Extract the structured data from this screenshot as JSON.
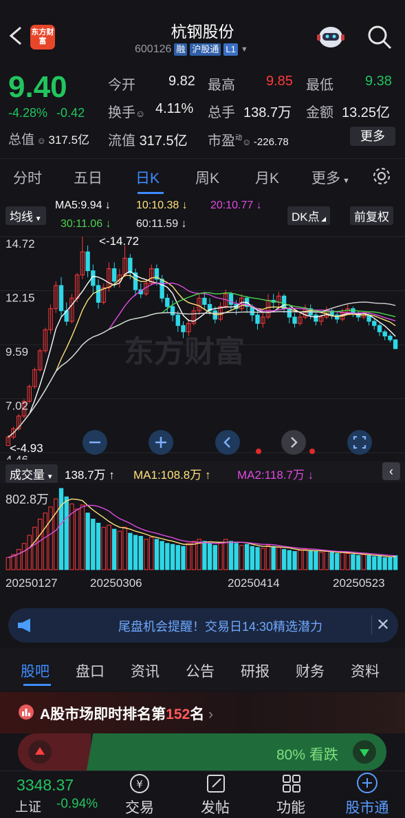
{
  "header": {
    "logo_text": "东方财富",
    "title": "杭钢股份",
    "code": "600126",
    "tags": [
      "融",
      "沪股通",
      "L1"
    ]
  },
  "quote": {
    "price": "9.40",
    "change_pct": "-4.28%",
    "change": "-0.42",
    "fields": [
      {
        "label": "今开",
        "value": "9.82",
        "color": "#f0f0f0"
      },
      {
        "label": "最高",
        "value": "9.85",
        "color": "#ff3a3a"
      },
      {
        "label": "最低",
        "value": "9.38",
        "color": "#22c45e"
      },
      {
        "label": "换手",
        "value": "4.11%",
        "color": "#f0f0f0"
      },
      {
        "label": "总手",
        "value": "138.7万",
        "color": "#f0f0f0"
      },
      {
        "label": "金额",
        "value": "13.25亿",
        "color": "#f0f0f0"
      }
    ],
    "total_cap_label": "总值",
    "total_cap": "317.5亿",
    "float_cap_label": "流值",
    "float_cap": "317.5亿",
    "pe_label": "市盈",
    "pe_sup": "动",
    "pe": "-226.78",
    "more": "更多"
  },
  "tabs": [
    "分时",
    "五日",
    "日K",
    "周K",
    "月K",
    "更多"
  ],
  "active_tab": "日K",
  "chart_controls": {
    "ma_selector": "均线",
    "ma5": "MA5:9.94 ↓",
    "ma10": "10:10.38 ↓",
    "ma20": "20:10.77 ↓",
    "ma30": "30:11.06 ↓",
    "ma60": "60:11.59 ↓",
    "dk": "DK点",
    "adjust": "前复权",
    "high_marker": "<-14.72",
    "low_marker": "<-4.93",
    "watermark": "东方财富",
    "y_axis": [
      "14.72",
      "12.15",
      "9.59",
      "7.02",
      "4.46"
    ],
    "vol_selector": "成交量",
    "vol": "138.7万 ↑",
    "vol_ma1": "MA1:108.8万 ↑",
    "vol_ma2": "MA2:118.7万 ↓",
    "vol_max": "802.8万",
    "dates": [
      "20250127",
      "20250306",
      "20250414",
      "20250523"
    ]
  },
  "colors": {
    "up": "#ff3a3a",
    "down": "#2fd7e6",
    "ma5": "#ffffff",
    "ma10": "#ffe27a",
    "ma20": "#e04be0",
    "ma30": "#4fd24f",
    "ma60": "#d8d8d8",
    "accent": "#3f8cff",
    "green": "#22c45e"
  },
  "chart_data": {
    "type": "candlestick",
    "y_range": [
      4.46,
      14.72
    ],
    "candles": [
      [
        4.8,
        5.2,
        5.3,
        4.9
      ],
      [
        5.2,
        5.6,
        5.7,
        5.1
      ],
      [
        5.6,
        6.2,
        6.3,
        5.5
      ],
      [
        6.2,
        6.9,
        7.0,
        6.1
      ],
      [
        6.9,
        7.6,
        7.7,
        6.8
      ],
      [
        7.6,
        8.4,
        8.5,
        7.5
      ],
      [
        8.4,
        9.3,
        9.4,
        8.3
      ],
      [
        9.3,
        10.3,
        10.4,
        9.2
      ],
      [
        10.3,
        11.3,
        11.5,
        10.1
      ],
      [
        11.3,
        12.4,
        12.6,
        11.1
      ],
      [
        12.4,
        11.2,
        12.8,
        10.9
      ],
      [
        11.2,
        10.7,
        11.6,
        10.5
      ],
      [
        10.7,
        11.8,
        12.0,
        10.6
      ],
      [
        11.8,
        12.9,
        13.0,
        11.6
      ],
      [
        12.9,
        14.0,
        14.72,
        12.7
      ],
      [
        14.0,
        13.1,
        14.3,
        12.8
      ],
      [
        13.1,
        12.4,
        13.4,
        12.0
      ],
      [
        12.4,
        11.6,
        12.7,
        11.3
      ],
      [
        11.6,
        12.3,
        12.5,
        11.5
      ],
      [
        12.3,
        13.2,
        13.5,
        12.1
      ],
      [
        13.2,
        12.6,
        13.5,
        12.3
      ],
      [
        12.6,
        12.9,
        13.2,
        12.3
      ],
      [
        12.9,
        13.7,
        14.3,
        12.8
      ],
      [
        13.7,
        13.0,
        13.9,
        12.7
      ],
      [
        13.0,
        12.2,
        13.2,
        11.9
      ],
      [
        12.2,
        12.0,
        12.5,
        11.8
      ],
      [
        12.0,
        12.5,
        12.7,
        11.9
      ],
      [
        12.5,
        13.2,
        13.4,
        12.4
      ],
      [
        13.2,
        12.7,
        13.4,
        12.4
      ],
      [
        12.7,
        11.8,
        12.9,
        11.6
      ],
      [
        11.8,
        11.4,
        12.0,
        11.1
      ],
      [
        11.4,
        11.0,
        11.7,
        10.7
      ],
      [
        11.0,
        10.5,
        11.2,
        10.2
      ],
      [
        10.5,
        10.2,
        10.7,
        9.9
      ],
      [
        10.2,
        10.6,
        10.8,
        10.0
      ],
      [
        10.6,
        11.2,
        11.4,
        10.5
      ],
      [
        11.2,
        11.8,
        12.0,
        11.0
      ],
      [
        11.8,
        11.5,
        12.1,
        11.3
      ],
      [
        11.5,
        11.2,
        11.8,
        11.0
      ],
      [
        11.2,
        10.8,
        11.4,
        10.6
      ],
      [
        10.8,
        11.4,
        11.6,
        10.7
      ],
      [
        11.4,
        12.0,
        12.2,
        11.3
      ],
      [
        12.0,
        11.5,
        12.1,
        11.2
      ],
      [
        11.5,
        11.3,
        11.7,
        11.0
      ],
      [
        11.3,
        11.8,
        12.0,
        11.2
      ],
      [
        11.8,
        11.4,
        11.9,
        11.1
      ],
      [
        11.4,
        11.0,
        11.5,
        10.7
      ],
      [
        11.0,
        10.6,
        11.2,
        10.3
      ],
      [
        10.6,
        10.9,
        11.1,
        10.4
      ],
      [
        10.9,
        11.7,
        12.0,
        10.8
      ],
      [
        11.7,
        11.6,
        12.0,
        11.3
      ],
      [
        11.6,
        11.9,
        12.1,
        11.4
      ],
      [
        11.9,
        11.3,
        12.0,
        11.1
      ],
      [
        11.3,
        10.9,
        11.4,
        10.6
      ],
      [
        10.9,
        10.6,
        11.1,
        10.4
      ],
      [
        10.6,
        10.9,
        11.1,
        10.5
      ],
      [
        10.9,
        11.3,
        11.5,
        10.8
      ],
      [
        11.3,
        11.0,
        11.5,
        10.8
      ],
      [
        11.0,
        10.7,
        11.1,
        10.5
      ],
      [
        10.7,
        10.9,
        11.0,
        10.5
      ],
      [
        10.9,
        11.2,
        11.4,
        10.8
      ],
      [
        11.2,
        11.0,
        11.3,
        10.8
      ],
      [
        11.0,
        10.8,
        11.1,
        10.6
      ],
      [
        10.8,
        11.1,
        11.3,
        10.7
      ],
      [
        11.1,
        11.3,
        11.5,
        11.0
      ],
      [
        11.3,
        11.1,
        11.4,
        10.9
      ],
      [
        11.1,
        10.9,
        11.2,
        10.7
      ],
      [
        10.9,
        11.0,
        11.2,
        10.8
      ],
      [
        11.0,
        10.7,
        11.1,
        10.5
      ],
      [
        10.7,
        10.5,
        10.8,
        10.3
      ],
      [
        10.5,
        10.2,
        10.6,
        10.0
      ],
      [
        10.2,
        10.0,
        10.3,
        9.8
      ],
      [
        10.0,
        9.82,
        10.1,
        9.7
      ],
      [
        9.82,
        9.4,
        9.85,
        9.38
      ]
    ],
    "volume": [
      120,
      150,
      200,
      260,
      340,
      420,
      500,
      560,
      620,
      700,
      802.8,
      720,
      650,
      600,
      640,
      560,
      500,
      460,
      420,
      440,
      400,
      380,
      420,
      360,
      340,
      330,
      300,
      320,
      300,
      280,
      260,
      250,
      240,
      230,
      260,
      280,
      300,
      280,
      260,
      240,
      270,
      300,
      280,
      260,
      240,
      250,
      230,
      220,
      210,
      240,
      230,
      220,
      200,
      190,
      180,
      190,
      200,
      190,
      180,
      170,
      180,
      170,
      160,
      170,
      160,
      150,
      140,
      150,
      140,
      130,
      130,
      120,
      120,
      138.7
    ]
  },
  "banner": {
    "text": "尾盘机会提醒！交易日14:30精选潜力"
  },
  "bottom_tabs": [
    "股吧",
    "盘口",
    "资讯",
    "公告",
    "研报",
    "财务",
    "资料"
  ],
  "active_bottom_tab": "股吧",
  "rank": {
    "prefix": "A股市场即时排名第",
    "number": "152",
    "suffix": "名"
  },
  "sentiment": {
    "pct": "80%",
    "label": "看跌"
  },
  "index": {
    "value": "3348.37",
    "name": "上证",
    "change": "-0.94%"
  },
  "nav": [
    "交易",
    "发帖",
    "功能",
    "股市通"
  ]
}
